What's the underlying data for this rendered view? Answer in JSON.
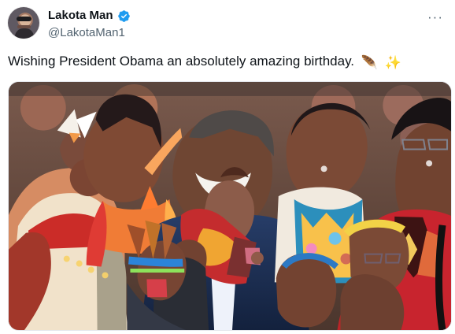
{
  "tweet": {
    "author": {
      "display_name": "Lakota Man",
      "handle": "@LakotaMan1",
      "verified": true
    },
    "text": "Wishing President Obama an absolutely amazing birthday.",
    "emoji_1": "🪶",
    "emoji_2": "✨",
    "more_label": "···",
    "media": {
      "type": "photo",
      "icon": "group-photo-image"
    }
  },
  "colors": {
    "text_primary": "#0f1419",
    "text_secondary": "#536471",
    "verified_blue": "#1d9bf0",
    "border": "#e6e9ee"
  }
}
